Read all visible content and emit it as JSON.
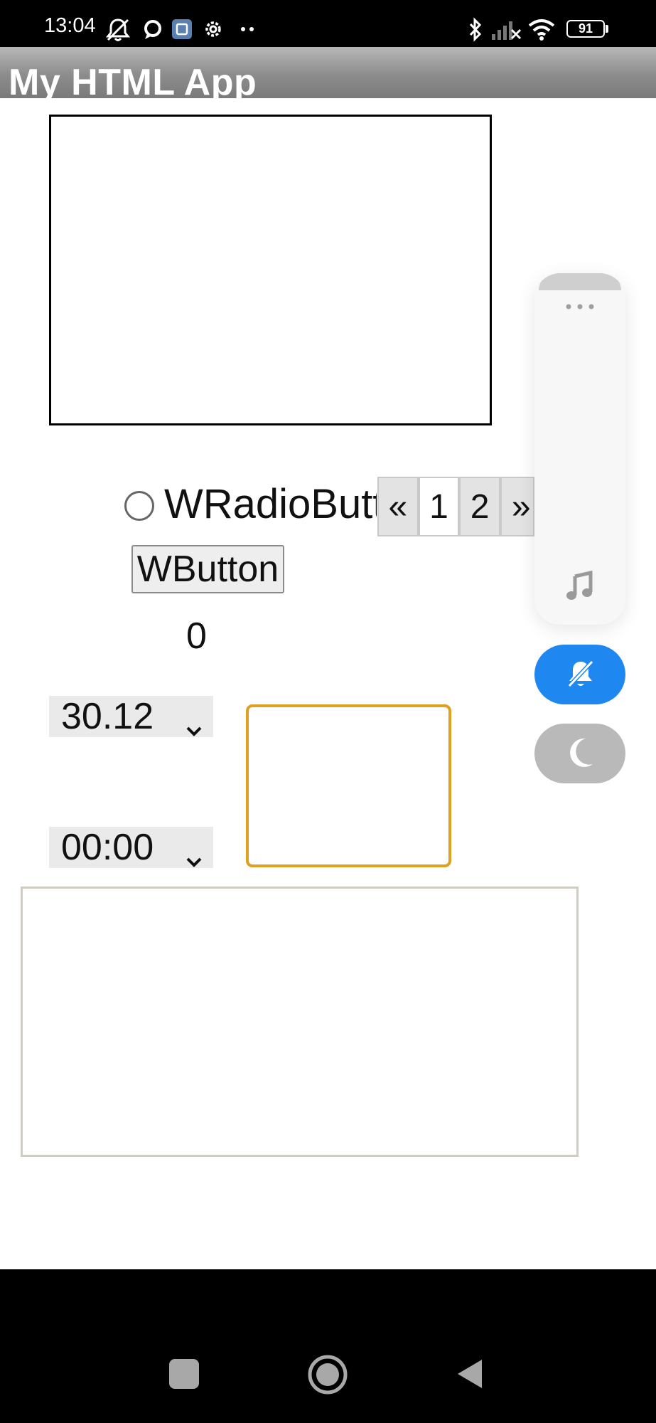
{
  "status_bar": {
    "time": "13:04",
    "battery": "91",
    "icons": [
      "silent-mode-icon",
      "chat-bubble-icon",
      "app-notification-icon",
      "settings-gear-icon",
      "more-dots-icon",
      "bluetooth-icon",
      "cell-signal-icon",
      "wifi-icon",
      "battery-icon"
    ]
  },
  "app": {
    "title": "My HTML App"
  },
  "radio": {
    "label": "WRadioButton"
  },
  "pagination": {
    "prev": "«",
    "pages": [
      "1",
      "2"
    ],
    "current": "1",
    "next": "»"
  },
  "button": {
    "label": "WButton"
  },
  "counter": {
    "value": "0"
  },
  "date_select": {
    "value": "30.12"
  },
  "time_select": {
    "value": "00:00"
  },
  "floating_panel": {
    "icons": [
      "more-dots-icon",
      "music-note-icon",
      "bell-mute-icon",
      "moon-icon"
    ],
    "colors": {
      "bell_button": "#1e88f0",
      "moon_button": "#b9b9b9"
    }
  },
  "nav_bar": {
    "icons": [
      "recent-apps-icon",
      "home-icon",
      "back-icon"
    ]
  },
  "colors": {
    "focus_border": "#e0a020",
    "title_bar": "#8c8c8c"
  }
}
